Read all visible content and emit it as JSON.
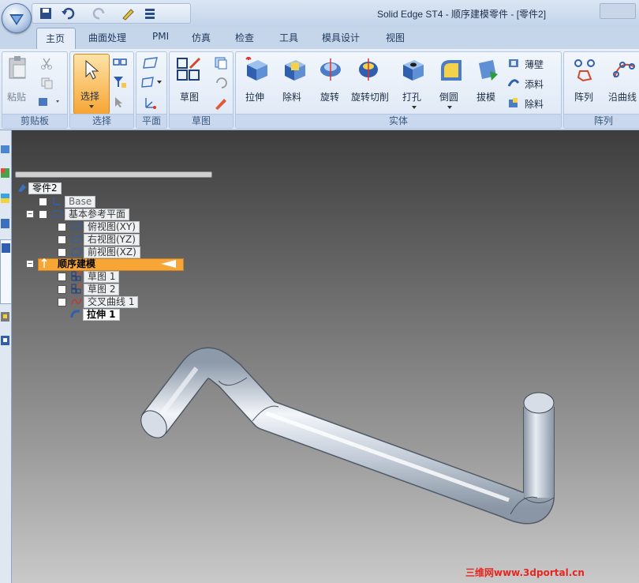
{
  "window": {
    "title": "Solid Edge ST4 - 顺序建模零件 - [零件2]"
  },
  "tabs": [
    "主页",
    "曲面处理",
    "PMI",
    "仿真",
    "检查",
    "工具",
    "模具设计",
    "视图"
  ],
  "ribbon": {
    "clipboard": {
      "paste": "粘贴",
      "label": "剪贴板"
    },
    "select": {
      "select": "选择",
      "label": "选择"
    },
    "plane": {
      "label": "平面"
    },
    "sketch": {
      "sketch": "草图",
      "label": "草图"
    },
    "solid": {
      "extrude": "拉伸",
      "cut": "除料",
      "revolve": "旋转",
      "revolve_cut": "旋转切削",
      "hole": "打孔",
      "round": "倒圆",
      "draft": "拔模",
      "thin_wall": "薄壁",
      "add": "添料",
      "remove": "除料",
      "label": "实体"
    },
    "pattern": {
      "pattern": "阵列",
      "along_curve": "沿曲线",
      "label": "阵列"
    }
  },
  "tree": {
    "root": "零件2",
    "items": [
      {
        "label": "Base"
      },
      {
        "label": "基本参考平面"
      },
      {
        "label": "俯视图(XY)"
      },
      {
        "label": "右视图(YZ)"
      },
      {
        "label": "前视图(XZ)"
      },
      {
        "label": "顺序建模"
      },
      {
        "label": "草图 1"
      },
      {
        "label": "草图 2"
      },
      {
        "label": "交叉曲线 1"
      },
      {
        "label": "拉伸 1"
      }
    ]
  },
  "watermark": "三维网www.3dportal.cn",
  "colors": {
    "accent": "#f7a535",
    "ribbon": "#dce7f5",
    "tube": "#c8d2de"
  }
}
